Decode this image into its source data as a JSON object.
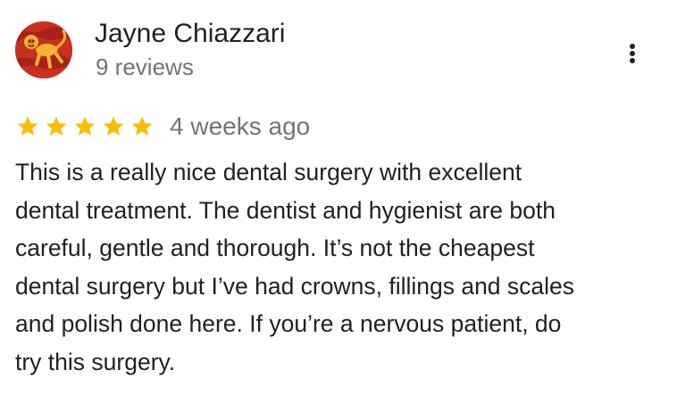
{
  "reviewer": {
    "name": "Jayne Chiazzari",
    "review_count": "9 reviews",
    "avatar_icon": "monkey-avatar-icon",
    "avatar_colors": {
      "background": "#c8311f",
      "figure": "#f2b534"
    }
  },
  "review": {
    "rating": 5,
    "max_rating": 5,
    "star_color": "#fbbc04",
    "date": "4 weeks ago",
    "text_lines": [
      "This is a really nice dental surgery with excellent",
      "dental treatment. The dentist and hygienist are both",
      "careful, gentle and thorough. It’s not the cheapest",
      "dental surgery but I’ve had crowns, fillings and scales",
      "and polish done here. If you’re a nervous patient, do",
      "try this surgery."
    ]
  },
  "actions": {
    "more_icon": "more-vertical-icon"
  }
}
